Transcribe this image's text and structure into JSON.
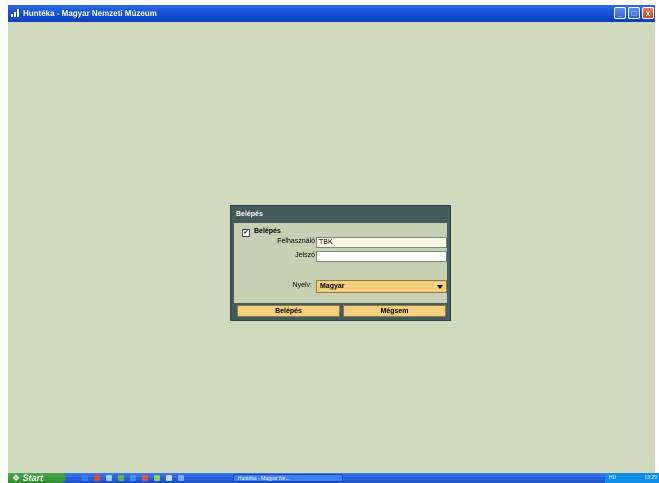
{
  "window": {
    "title": "Huntéka - Magyar Nemzeti Múzeum",
    "minimize": "_",
    "maximize": "□",
    "close": "x"
  },
  "dialog": {
    "title": "Belépés",
    "section_label": "Belépés",
    "section_checked": true,
    "username_label": "Felhasználó",
    "username_value": "TBK",
    "password_label": "Jelszó",
    "password_value": "",
    "language_label": "Nyelv:",
    "language_value": "Magyar",
    "login_button": "Belépés",
    "cancel_button": "Mégsem"
  },
  "taskbar": {
    "start_label": "Start",
    "task_label": "Huntéka - Magyar Ne...",
    "language": "HU",
    "clock": "13:29"
  },
  "colors": {
    "background": "#d1dabd",
    "dialog_frame": "#445b5c",
    "button_fill": "#f3cf7e",
    "titlebar": "#1350d4"
  },
  "icons": [
    "app-icon",
    "checkbox-check-icon",
    "dropdown-arrow-icon",
    "start-logo-icon"
  ]
}
